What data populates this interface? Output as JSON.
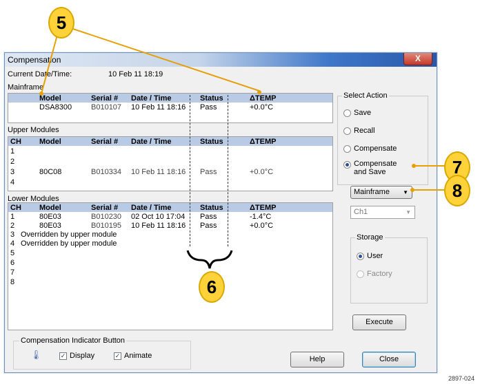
{
  "window": {
    "title": "Compensation",
    "close_glyph": "X"
  },
  "current": {
    "label": "Current Date/Time:",
    "value": "10 Feb 11 18:19"
  },
  "mainframe": {
    "label": "Mainframe",
    "headers": [
      "Model",
      "Serial #",
      "Date / Time",
      "Status",
      "ΔTEMP"
    ],
    "row": [
      "DSA8300",
      "B010107",
      "10 Feb 11 18:16",
      "Pass",
      "+0.0°C"
    ]
  },
  "upper": {
    "label": "Upper Modules",
    "headers": [
      "CH",
      "Model",
      "Serial #",
      "Date / Time",
      "Status",
      "ΔTEMP"
    ],
    "rows": [
      {
        "ch": "1"
      },
      {
        "ch": "2"
      },
      {
        "ch": "3",
        "model": "80C08",
        "serial": "B010334",
        "datetime": "10 Feb 11 18:16",
        "status": "Pass",
        "temp": "+0.0°C"
      },
      {
        "ch": "4"
      }
    ]
  },
  "lower": {
    "label": "Lower Modules",
    "headers": [
      "CH",
      "Model",
      "Serial #",
      "Date / Time",
      "Status",
      "ΔTEMP"
    ],
    "rows": [
      {
        "ch": "1",
        "model": "80E03",
        "serial": "B010230",
        "datetime": "02 Oct 10 17:04",
        "status": "Pass",
        "temp": "-1.4°C"
      },
      {
        "ch": "2",
        "model": "80E03",
        "serial": "B010195",
        "datetime": "10 Feb 11 18:16",
        "status": "Pass",
        "temp": "+0.0°C"
      },
      {
        "ch": "3",
        "model": "Overridden by upper module"
      },
      {
        "ch": "4",
        "model": "Overridden by upper module"
      },
      {
        "ch": "5"
      },
      {
        "ch": "6"
      },
      {
        "ch": "7"
      },
      {
        "ch": "8"
      }
    ]
  },
  "select_action": {
    "title": "Select Action",
    "options": [
      "Save",
      "Recall",
      "Compensate",
      "Compensate and Save"
    ],
    "selected": "Compensate and Save"
  },
  "dropdowns": {
    "target": "Mainframe",
    "channel": "Ch1"
  },
  "storage": {
    "title": "Storage",
    "options": [
      "User",
      "Factory"
    ],
    "selected": "User"
  },
  "buttons": {
    "execute": "Execute",
    "help": "Help",
    "close": "Close"
  },
  "indicator": {
    "title": "Compensation Indicator Button",
    "display": "Display",
    "animate": "Animate"
  },
  "callouts": [
    "5",
    "6",
    "7",
    "8"
  ],
  "figure_id": "2897-024"
}
